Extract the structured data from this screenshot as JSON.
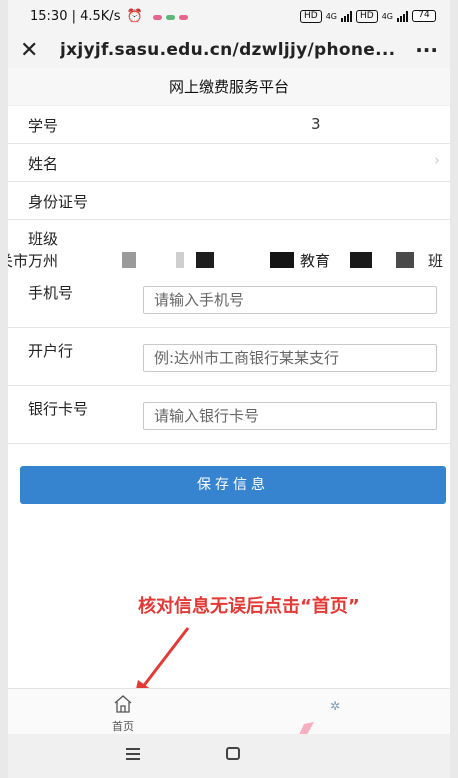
{
  "status_bar": {
    "time_speed": "15:30 | 4.5K/s",
    "hd": "HD",
    "network": "4G",
    "battery": "74"
  },
  "browser": {
    "url": "jxjyjf.sasu.edu.cn/dzwljjy/phone...",
    "close_icon": "close-icon",
    "more_icon": "more-icon"
  },
  "page": {
    "title": "网上缴费服务平台"
  },
  "form": {
    "student_id_label": "学号",
    "student_id_value": "3",
    "name_label": "姓名",
    "id_card_label": "身份证号",
    "class_label": "班级",
    "class_value_parts": [
      "关市万州",
      "教育",
      "班"
    ],
    "phone_label": "手机号",
    "phone_placeholder": "请输入手机号",
    "bank_label": "开户行",
    "bank_placeholder": "例:达州市工商银行某某支行",
    "card_label": "银行卡号",
    "card_placeholder": "请输入银行卡号"
  },
  "save_button": "保存信息",
  "annotation_text": "核对信息无误后点击“首页”",
  "bottom_nav": {
    "home_label": "首页",
    "home_icon": "home-icon"
  },
  "colors": {
    "primary": "#3683d0",
    "annotation": "#e53935"
  }
}
